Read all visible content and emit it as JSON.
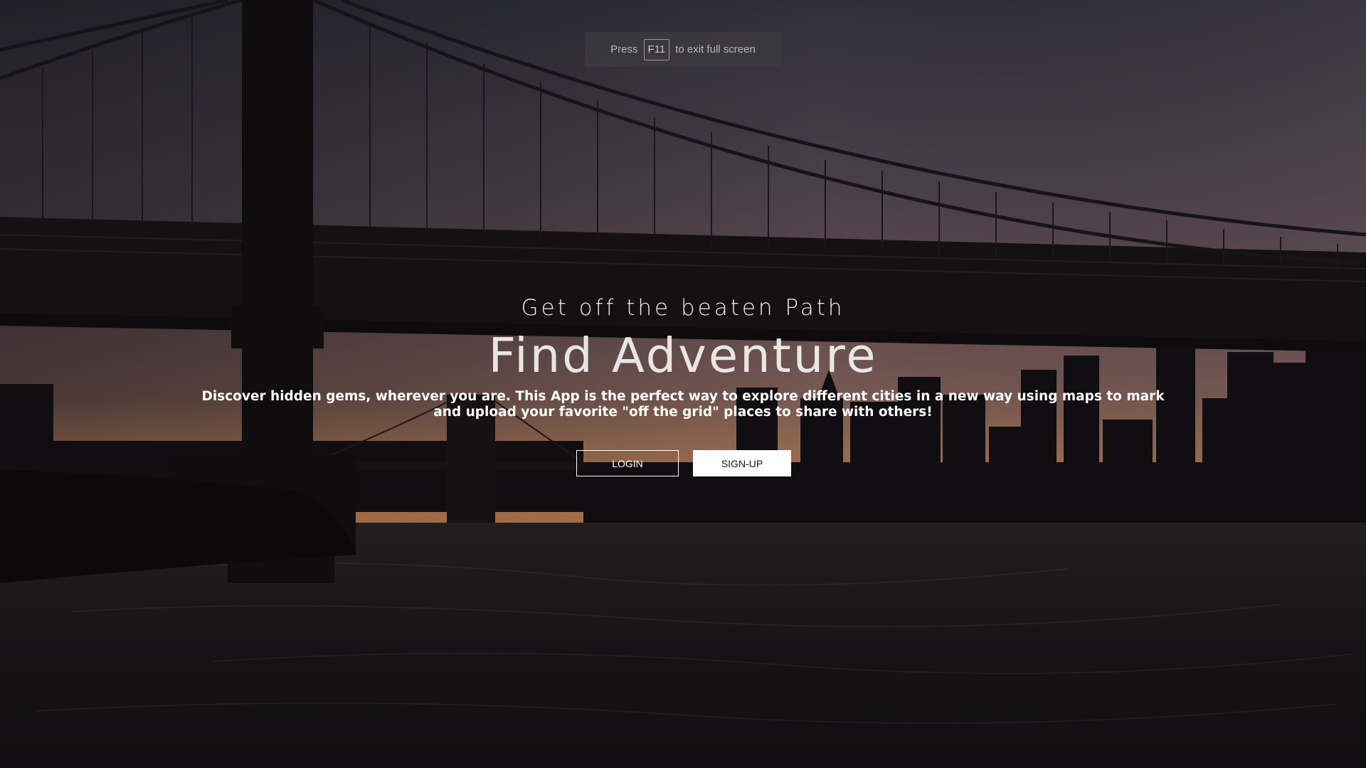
{
  "fullscreen_notice": {
    "press_label": "Press",
    "key_label": "F11",
    "suffix_label": "to exit full screen"
  },
  "hero": {
    "tagline": "Get off the beaten Path",
    "headline": "Find Adventure",
    "description": "Discover hidden gems, wherever you are. This App is the perfect way to explore different cities in a new way using maps to mark and upload your favorite \"off the grid\" places to share with others!"
  },
  "actions": {
    "login_label": "LOGIN",
    "signup_label": "SIGN-UP"
  }
}
